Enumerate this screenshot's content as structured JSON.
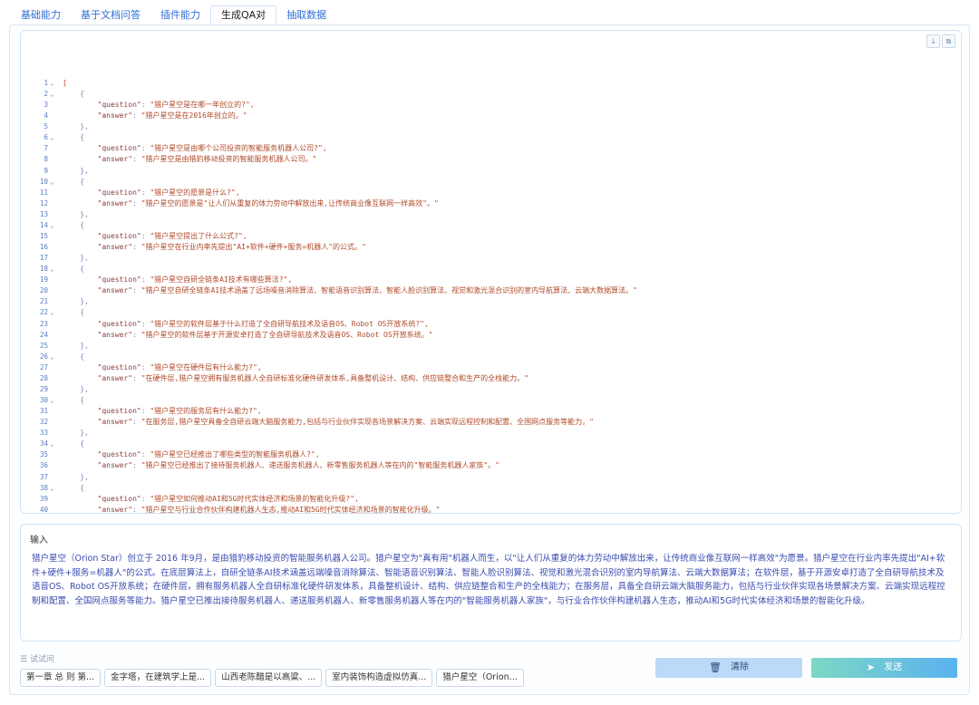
{
  "tabs": [
    "基础能力",
    "基于文档问答",
    "插件能力",
    "生成QA对",
    "抽取数据"
  ],
  "active_tab": 3,
  "editor": {
    "download_icon": "download-icon",
    "copy_icon": "copy-icon",
    "qa": [
      {
        "q": "猎户星空是在哪一年创立的?",
        "a": "猎户星空是在2016年创立的。"
      },
      {
        "q": "猎户星空是由哪个公司投资的智能服务机器人公司?",
        "a": "猎户星空是由猎豹移动投资的智能服务机器人公司。"
      },
      {
        "q": "猎户星空的愿景是什么?",
        "a": "猎户星空的愿景是\"让人们从重复的体力劳动中解放出来,让传统商业像互联网一样高效\"。"
      },
      {
        "q": "猎户星空提出了什么公式?",
        "a": "猎户星空在行业内率先提出\"AI+软件+硬件+服务=机器人\"的公式。"
      },
      {
        "q": "猎户星空自研全链条AI技术有哪些算法?",
        "a": "猎户星空自研全链条AI技术涵盖了远场噪音消除算法、智能语音识别算法、智能人脸识别算法、视觉和激光混合识别的室内导航算法、云端大数据算法。"
      },
      {
        "q": "猎户星空的软件层基于什么打造了全自研导航技术及语音OS、Robot OS开放系统?",
        "a": "猎户星空的软件层基于开源安卓打造了全自研导航技术及语音OS、Robot OS开放系统。"
      },
      {
        "q": "猎户星空在硬件层有什么能力?",
        "a": "在硬件层,猎户星空拥有服务机器人全自研标准化硬件研发体系,具备整机设计、结构、供应链整合和生产的全栈能力。"
      },
      {
        "q": "猎户星空的服务层有什么能力?",
        "a": "在服务层,猎户星空具备全自研云端大脑服务能力,包括与行业伙伴实现各场景解决方案、云端实现远程控制和配置、全国网点服务等能力。"
      },
      {
        "q": "猎户星空已经推出了哪些类型的智能服务机器人?",
        "a": "猎户星空已经推出了接待服务机器人、递送服务机器人、新零售服务机器人等在内的\"智能服务机器人家族\"。"
      },
      {
        "q": "猎户星空如何推动AI和5G时代实体经济和场景的智能化升级?",
        "a": "猎户星空与行业合作伙伴构建机器人生态,推动AI和5G时代实体经济和场景的智能化升级。"
      }
    ]
  },
  "input": {
    "label": "输入",
    "text": "猎户星空（Orion Star）创立于 2016 年9月，是由猎豹移动投资的智能服务机器人公司。猎户星空为\"真有用\"机器人而生，以\"让人们从重复的体力劳动中解放出来，让传统商业像互联网一样高效\"为愿景。猎户星空在行业内率先提出\"AI+软件+硬件+服务=机器人\"的公式。在底层算法上，自研全链条AI技术涵盖远端噪音消除算法、智能语音识别算法、智能人脸识别算法、视觉和激光混合识别的室内导航算法、云端大数据算法；在软件层，基于开源安卓打造了全自研导航技术及语音OS、Robot OS开放系统；在硬件层，拥有服务机器人全自研标准化硬件研发体系，具备整机设计、结构、供应链整合和生产的全栈能力；在服务层，具备全自研云端大脑服务能力，包括与行业伙伴实现各场景解决方案、云端实现远程控制和配置、全国网点服务等能力。猎户星空已推出接待服务机器人、递送服务机器人、新零售服务机器人等在内的\"智能服务机器人家族\"，与行业合作伙伴构建机器人生态，推动AI和5G时代实体经济和场景的智能化升级。"
  },
  "try": {
    "label": "试试问",
    "chips": [
      "第一章 总 则 第...",
      "金字塔，在建筑学上是...",
      "山西老陈醋是以高粱、...",
      "室内装饰构造虚拟仿真...",
      "猎户星空（Orion..."
    ]
  },
  "buttons": {
    "clear": "清除",
    "send": "发送"
  }
}
